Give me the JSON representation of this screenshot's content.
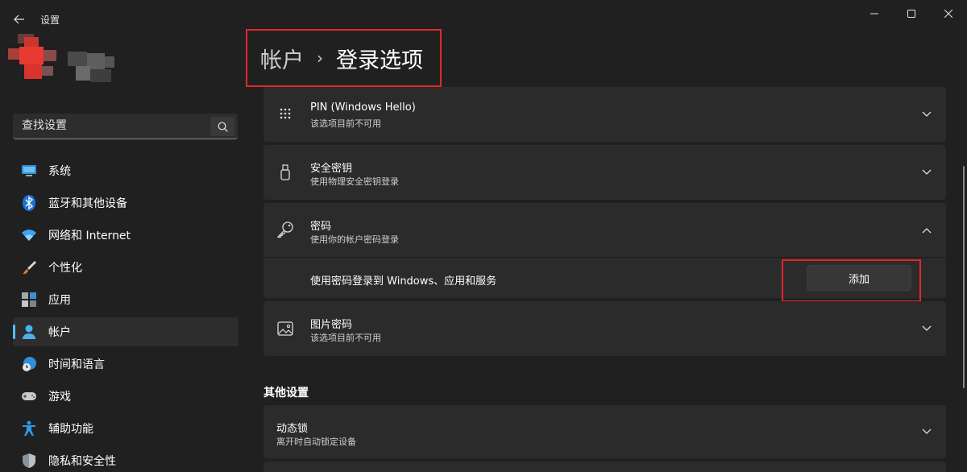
{
  "app": {
    "title": "设置"
  },
  "search": {
    "placeholder": "查找设置"
  },
  "sidebar": {
    "items": [
      {
        "label": "系统",
        "icon": "monitor-icon"
      },
      {
        "label": "蓝牙和其他设备",
        "icon": "bluetooth-icon"
      },
      {
        "label": "网络和 Internet",
        "icon": "wifi-icon"
      },
      {
        "label": "个性化",
        "icon": "brush-icon"
      },
      {
        "label": "应用",
        "icon": "apps-icon"
      },
      {
        "label": "帐户",
        "icon": "person-icon",
        "active": true
      },
      {
        "label": "时间和语言",
        "icon": "globe-clock-icon"
      },
      {
        "label": "游戏",
        "icon": "gamepad-icon"
      },
      {
        "label": "辅助功能",
        "icon": "accessibility-icon"
      },
      {
        "label": "隐私和安全性",
        "icon": "shield-icon"
      }
    ]
  },
  "breadcrumb": {
    "parent": "帐户",
    "separator": "›",
    "current": "登录选项"
  },
  "cards": {
    "pin": {
      "title": "PIN (Windows Hello)",
      "subtitle": "该选项目前不可用"
    },
    "security_key": {
      "title": "安全密钥",
      "subtitle": "使用物理安全密钥登录"
    },
    "password": {
      "title": "密码",
      "subtitle": "使用你的帐户密码登录",
      "expanded_text": "使用密码登录到 Windows、应用和服务",
      "add_label": "添加"
    },
    "picture_password": {
      "title": "图片密码",
      "subtitle": "该选项目前不可用"
    }
  },
  "other_settings": {
    "title": "其他设置",
    "dynamic_lock": {
      "title": "动态锁",
      "subtitle": "离开时自动锁定设备"
    }
  },
  "colors": {
    "accent": "#4cc2ff",
    "highlight": "#e3262b",
    "background": "#202020",
    "card": "#2b2b2b"
  }
}
